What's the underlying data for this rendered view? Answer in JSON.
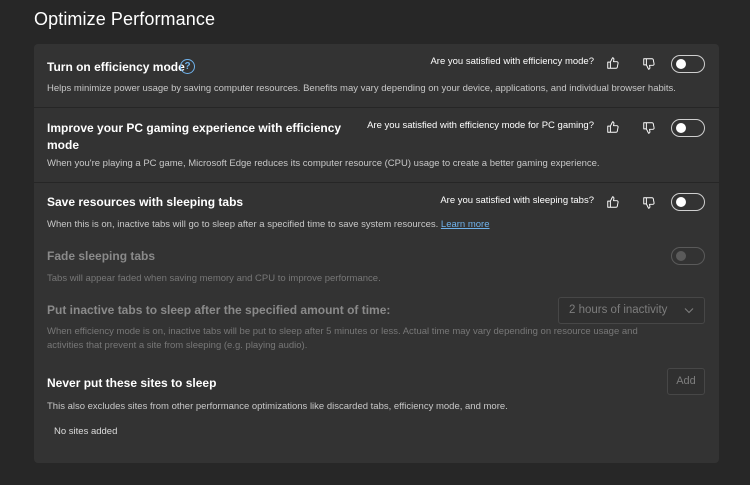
{
  "page": {
    "title": "Optimize Performance"
  },
  "efficiency": {
    "title": "Turn on efficiency mode",
    "help_icon": "?",
    "survey": "Are you satisfied with efficiency mode?",
    "description": "Helps minimize power usage by saving computer resources. Benefits may vary depending on your device, applications, and individual browser habits.",
    "toggle_on": false
  },
  "gaming": {
    "title_line1": "Improve your PC gaming experience with efficiency",
    "title_line2": "mode",
    "survey": "Are you satisfied with efficiency mode for PC gaming?",
    "description": "When you're playing a PC game, Microsoft Edge reduces its computer resource (CPU) usage to create a better gaming experience.",
    "toggle_on": false
  },
  "sleeping": {
    "title": "Save resources with sleeping tabs",
    "survey": "Are you satisfied with sleeping tabs?",
    "description": "When this is on, inactive tabs will go to sleep after a specified time to save system resources.",
    "learn_more": "Learn more",
    "toggle_on": false
  },
  "fade": {
    "title": "Fade sleeping tabs",
    "description": "Tabs will appear faded when saving memory and CPU to improve performance.",
    "toggle_on": false,
    "disabled": true
  },
  "inactive": {
    "title": "Put inactive tabs to sleep after the specified amount of time:",
    "selected": "2 hours of inactivity",
    "description_line1": "When efficiency mode is on, inactive tabs will be put to sleep after 5 minutes or less. Actual time may vary depending on resource usage and",
    "description_line2": "activities that prevent a site from sleeping (e.g. playing audio)."
  },
  "never_sleep": {
    "title": "Never put these sites to sleep",
    "add_label": "Add",
    "description": "This also excludes sites from other performance optimizations like discarded tabs, efficiency mode, and more.",
    "empty_text": "No sites added"
  },
  "colors": {
    "background": "#272727",
    "card": "#333333",
    "accent": "#6fb2ec"
  }
}
